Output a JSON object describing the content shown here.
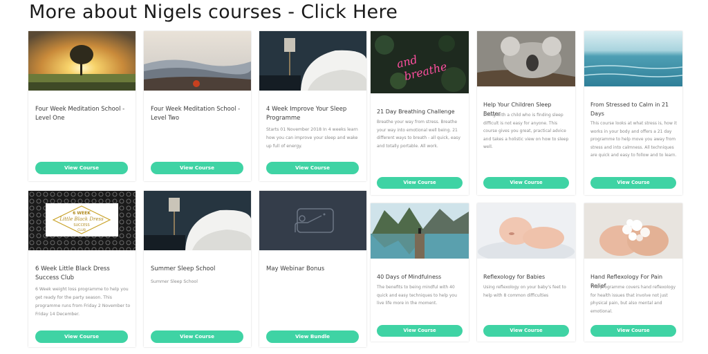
{
  "page": {
    "heading": "More about Nigels courses - Click Here"
  },
  "courses": [
    {
      "title": "Four Week Meditation School - Level One",
      "description": "",
      "button": "View Course",
      "thumb": "sunset-tree"
    },
    {
      "title": "Four Week Meditation School - Level Two",
      "description": "",
      "button": "View Course",
      "thumb": "misty-hills"
    },
    {
      "title": "4 Week Improve Your Sleep Programme",
      "description": "Starts 01 November 2018 In 4 weeks learn how you can improve your sleep and wake up full of energy.",
      "button": "View Course",
      "thumb": "bedroom"
    },
    {
      "title": "21 Day Breathing Challenge",
      "description": "Breathe your way from stress. Breathe your way into emotional well being. 21 different ways to breath - all quick, easy and totally portable. All work.",
      "button": "View Course",
      "thumb": "neon-breathe"
    },
    {
      "title": "Help Your Children Sleep Better",
      "description": "Living with a child who is finding sleep difficult is not easy for anyone. This course gives you great, practical advice and takes a holistic view on how to sleep well.",
      "button": "View Course",
      "thumb": "koala"
    },
    {
      "title": "From Stressed to Calm in 21 Days",
      "description": "This course looks at what stress is, how it works in your body and offers a 21 day programme to help move you away from stress and into calmness. All techniques are quick and easy to follow and to learn.",
      "button": "View Course",
      "thumb": "ocean"
    },
    {
      "title": "6 Week Little Black Dress Success Club",
      "description": "6 Week weight loss programme to help you get ready for the party season. This programme runs from Friday 2 November to Friday 14 December.",
      "button": "View Course",
      "thumb": "lace-badge"
    },
    {
      "title": "Summer Sleep School",
      "description": "Summer Sleep School",
      "button": "View Course",
      "thumb": "bedroom"
    },
    {
      "title": "May Webinar Bonus",
      "description": "",
      "button": "View Bundle",
      "thumb": "presentation"
    },
    {
      "title": "40 Days of Mindfulness",
      "description": "The benefits to being mindful with 40 quick and easy techniques to help you live life more in the moment.",
      "button": "View Course",
      "thumb": "lake-mountains"
    },
    {
      "title": "Reflexology for Babies",
      "description": "Using reflexology on your baby's feet to help with 8 common difficulties",
      "button": "View Course",
      "thumb": "baby"
    },
    {
      "title": "Hand Reflexology For Pain Relief",
      "description": "This programme covers hand reflexology for health issues that involve not just physical pain, but also mental and emotional.",
      "button": "View Course",
      "thumb": "hands-blossom"
    }
  ],
  "badge": {
    "line1": "6 WEEK",
    "line2": "Little Black Dress",
    "line3": "SUCCESS",
    "line4": "CLUB"
  },
  "neon": {
    "line1": "and",
    "line2": "breathe"
  },
  "colors": {
    "button": "#3fd3a4",
    "heading": "#1a1a1a"
  }
}
